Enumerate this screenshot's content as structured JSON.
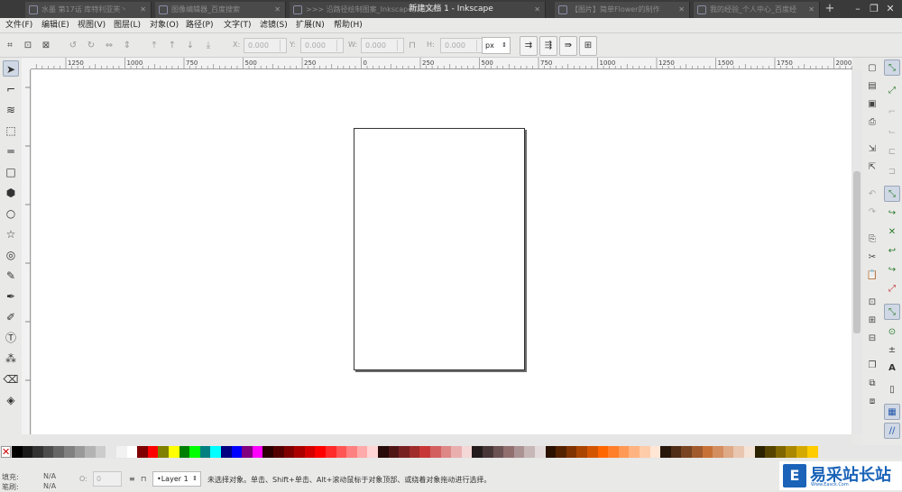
{
  "window": {
    "title": "新建文档 1 - Inkscape",
    "tabs": [
      {
        "label": "水墨 第17话 库特利亚芙丶"
      },
      {
        "label": "图像编辑器_百度搜索"
      },
      {
        "label": ">>> 沿路径绘制图案_Inkscape实现bez"
      },
      {
        "label": "【图片】简单Flower的制作"
      },
      {
        "label": "我的经验_个人中心_百度经"
      }
    ],
    "controls": {
      "minimize": "–",
      "restore": "❐",
      "close": "✕"
    }
  },
  "menu": [
    "文件(F)",
    "编辑(E)",
    "视图(V)",
    "图层(L)",
    "对象(O)",
    "路径(P)",
    "文字(T)",
    "滤镜(S)",
    "扩展(N)",
    "帮助(H)"
  ],
  "controls_bar": {
    "x_label": "X:",
    "x_value": "0.000",
    "y_label": "Y:",
    "y_value": "0.000",
    "w_label": "W:",
    "w_value": "0.000",
    "h_label": "H:",
    "h_value": "0.000",
    "unit": "px"
  },
  "ruler": {
    "labels": [
      "1250",
      "1000",
      "750",
      "500",
      "250",
      "0",
      "250",
      "500",
      "750",
      "1000",
      "1250",
      "1500",
      "1750",
      "2000"
    ]
  },
  "status": {
    "fill_label": "填充:",
    "fill_value": "N/A",
    "stroke_label": "笔刷:",
    "stroke_value": "N/A",
    "opacity_label": "O:",
    "opacity_value": "0",
    "layer": "•Layer 1",
    "message": "未选择对象。单击、Shift+单击、Alt+滚动鼠标于对象顶部、或绕着对象拖动进行选择。"
  },
  "watermark": {
    "name": "易采站长站",
    "sub": "Www.Easck.Com"
  },
  "colors": {
    "accent": "#1a63b8",
    "palette": [
      "#000000",
      "#1a1a1a",
      "#333333",
      "#4d4d4d",
      "#666666",
      "#808080",
      "#999999",
      "#b3b3b3",
      "#cccccc",
      "#e6e6e6",
      "#f2f2f2",
      "#ffffff",
      "#800000",
      "#ff0000",
      "#808000",
      "#ffff00",
      "#008000",
      "#00ff00",
      "#008080",
      "#00ffff",
      "#000080",
      "#0000ff",
      "#800080",
      "#ff00ff",
      "#2b0000",
      "#550000",
      "#800000",
      "#aa0000",
      "#d40000",
      "#ff0000",
      "#ff2a2a",
      "#ff5555",
      "#ff8080",
      "#ffaaaa",
      "#ffd5d5",
      "#280b0b",
      "#501616",
      "#782121",
      "#a02c2c",
      "#c83737",
      "#d35f5f",
      "#de8787",
      "#e9afaf",
      "#f4d7d7",
      "#241c1c",
      "#483737",
      "#6c5353",
      "#916f6f",
      "#ac9393",
      "#c8b7b7",
      "#e3dbdb",
      "#2b1100",
      "#552200",
      "#803300",
      "#aa4400",
      "#d45500",
      "#ff6600",
      "#ff7f2a",
      "#ff9955",
      "#ffb380",
      "#ffccaa",
      "#ffe6d5",
      "#28170b",
      "#502d16",
      "#784421",
      "#a05a2c",
      "#c87137",
      "#d38d5f",
      "#deaa87",
      "#e9c6af",
      "#f4e3d7",
      "#2b2200",
      "#554400",
      "#806600",
      "#aa8800",
      "#d4aa00",
      "#ffcc00"
    ]
  }
}
